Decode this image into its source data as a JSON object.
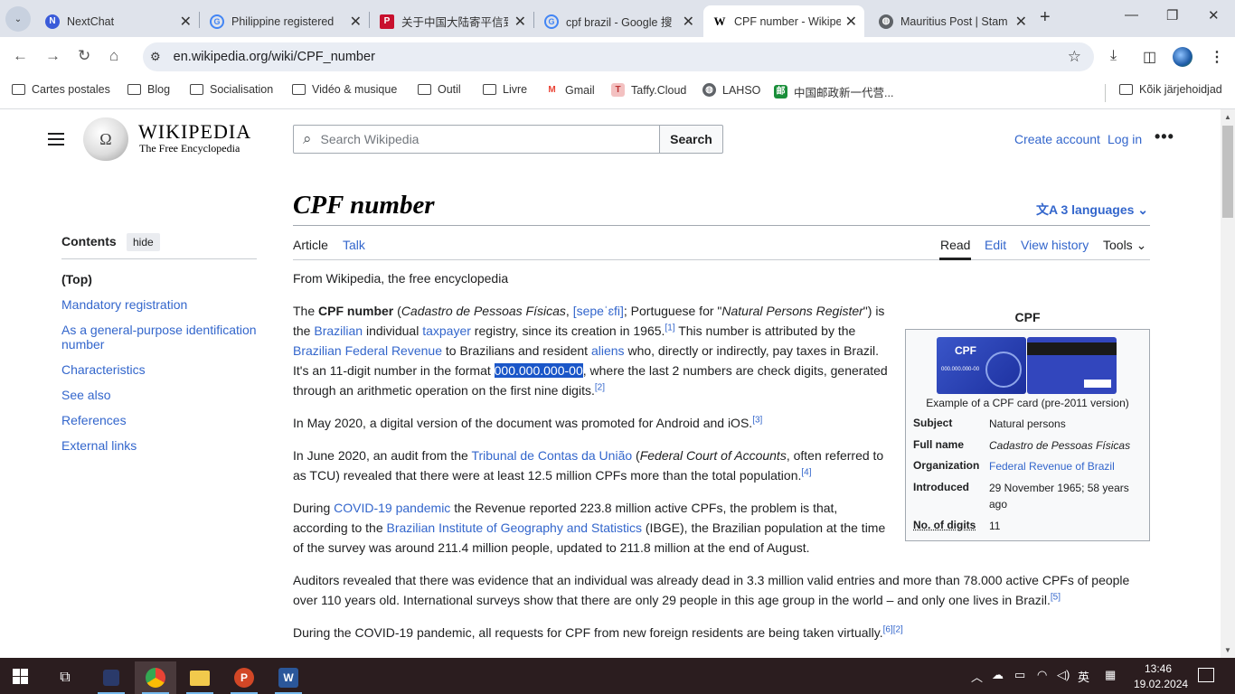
{
  "tabs": [
    {
      "title": "NextChat",
      "icon": "nextchat-icon",
      "color": "#3a5bd9"
    },
    {
      "title": "Philippine registered",
      "icon": "google-icon",
      "color": "#4285f4"
    },
    {
      "title": "关于中国大陆寄平信到",
      "icon": "pixiv-icon",
      "color": "#c8102e"
    },
    {
      "title": "cpf brazil - Google 搜",
      "icon": "google-icon",
      "color": "#4285f4"
    },
    {
      "title": "CPF number - Wikipe",
      "icon": "wikipedia-icon",
      "color": "#000000"
    },
    {
      "title": "Mauritius Post | Stamp",
      "icon": "globe-icon",
      "color": "#5f6368"
    }
  ],
  "address_bar": {
    "url": "en.wikipedia.org/wiki/CPF_number"
  },
  "bookmarks": [
    {
      "label": "Cartes postales",
      "icon": "folder-icon"
    },
    {
      "label": "Blog",
      "icon": "folder-icon"
    },
    {
      "label": "Socialisation",
      "icon": "folder-icon"
    },
    {
      "label": "Vidéo & musique",
      "icon": "folder-icon"
    },
    {
      "label": "Outil",
      "icon": "folder-icon"
    },
    {
      "label": "Livre",
      "icon": "folder-icon"
    },
    {
      "label": "Gmail",
      "icon": "gmail-icon"
    },
    {
      "label": "Taffy.Cloud",
      "icon": "taffy-icon"
    },
    {
      "label": "LAHSO",
      "icon": "globe-icon"
    },
    {
      "label": "中国邮政新一代营...",
      "icon": "china-post-icon"
    },
    {
      "label": "Kõik järjehoidjad",
      "icon": "folder-icon"
    }
  ],
  "wiki_header": {
    "wordmark": "WIKIPEDIA",
    "tagline": "The Free Encyclopedia",
    "search_placeholder": "Search Wikipedia",
    "search_button": "Search",
    "create_account": "Create account",
    "log_in": "Log in"
  },
  "toc": {
    "heading": "Contents",
    "hide": "hide",
    "items": [
      "(Top)",
      "Mandatory registration",
      "As a general-purpose identification number",
      "Characteristics",
      "See also",
      "References",
      "External links"
    ]
  },
  "article": {
    "title": "CPF number",
    "languages": "3 languages",
    "tab_article": "Article",
    "tab_talk": "Talk",
    "tab_read": "Read",
    "tab_edit": "Edit",
    "tab_history": "View history",
    "tab_tools": "Tools",
    "from": "From Wikipedia, the free encyclopedia",
    "p1": {
      "a": "The ",
      "b": "CPF number",
      "c": " (",
      "d": "Cadastro de Pessoas Físicas",
      "e": ", ",
      "f": "[sepeˈɛfi]",
      "g": "; Portuguese for \"",
      "h": "Natural Persons Register",
      "i": "\") is the ",
      "j": "Brazilian",
      "k": " individual ",
      "l": "taxpayer",
      "m": " registry, since its creation in 1965.",
      "n": "[1]",
      "o": " This number is attributed by the ",
      "p": "Brazilian Federal Revenue",
      "q": " to Brazilians and resident ",
      "r": "aliens",
      "s": " who, directly or indirectly, pay taxes in Brazil. It's an 11-digit number in the format ",
      "t": "000.000.000-00",
      "u": ", where the last 2 numbers are check digits, generated through an arithmetic operation on the first nine digits.",
      "v": "[2]"
    },
    "p2": {
      "a": "In May 2020, a digital version of the document was promoted for Android and iOS.",
      "b": "[3]"
    },
    "p3": {
      "a": "In June 2020, an audit from the ",
      "b": "Tribunal de Contas da União",
      "c": " (",
      "d": "Federal Court of Accounts",
      "e": ", often referred to as TCU) revealed that there were at least 12.5 million CPFs more than the total population.",
      "f": "[4]"
    },
    "p4": {
      "a": "During ",
      "b": "COVID-19 pandemic",
      "c": " the Revenue reported 223.8 million active CPFs, the problem is that, according to the ",
      "d": "Brazilian Institute of Geography and Statistics",
      "e": " (IBGE), the Brazilian population at the time of the survey was around 211.4 million people, updated to 211.8 million at the end of August."
    },
    "p5": {
      "a": "Auditors revealed that there was evidence that an individual was already dead in 3.3 million valid entries and more than 78.000 active CPFs of people over 110 years old. International surveys show that there are only 29 people in this age group in the world – and only one lives in Brazil.",
      "b": "[5]"
    },
    "p6": {
      "a": "During the COVID-19 pandemic, all requests for CPF from new foreign residents are being taken virtually.",
      "b": "[6]",
      "c": "[2]"
    }
  },
  "infobox": {
    "title": "CPF",
    "card_label": "CPF",
    "card_number": "000.000.000-00",
    "caption": "Example of a CPF card (pre-2011 version)",
    "rows": [
      {
        "label": "Subject",
        "value": "Natural persons"
      },
      {
        "label": "Full name",
        "value": "Cadastro de Pessoas Físicas"
      },
      {
        "label": "Organization",
        "value": "Federal Revenue of Brazil"
      },
      {
        "label": "Introduced",
        "value": "29 November 1965; 58 years ago"
      },
      {
        "label": "No. of digits",
        "value": "11"
      }
    ]
  },
  "taskbar": {
    "ime": "英",
    "time": "13:46",
    "date": "19.02.2024"
  },
  "colors": {
    "link": "#3366cc",
    "selection": "#1a56c8",
    "taskbar": "#2b1d1f",
    "tabstrip": "#dfe3eb"
  }
}
